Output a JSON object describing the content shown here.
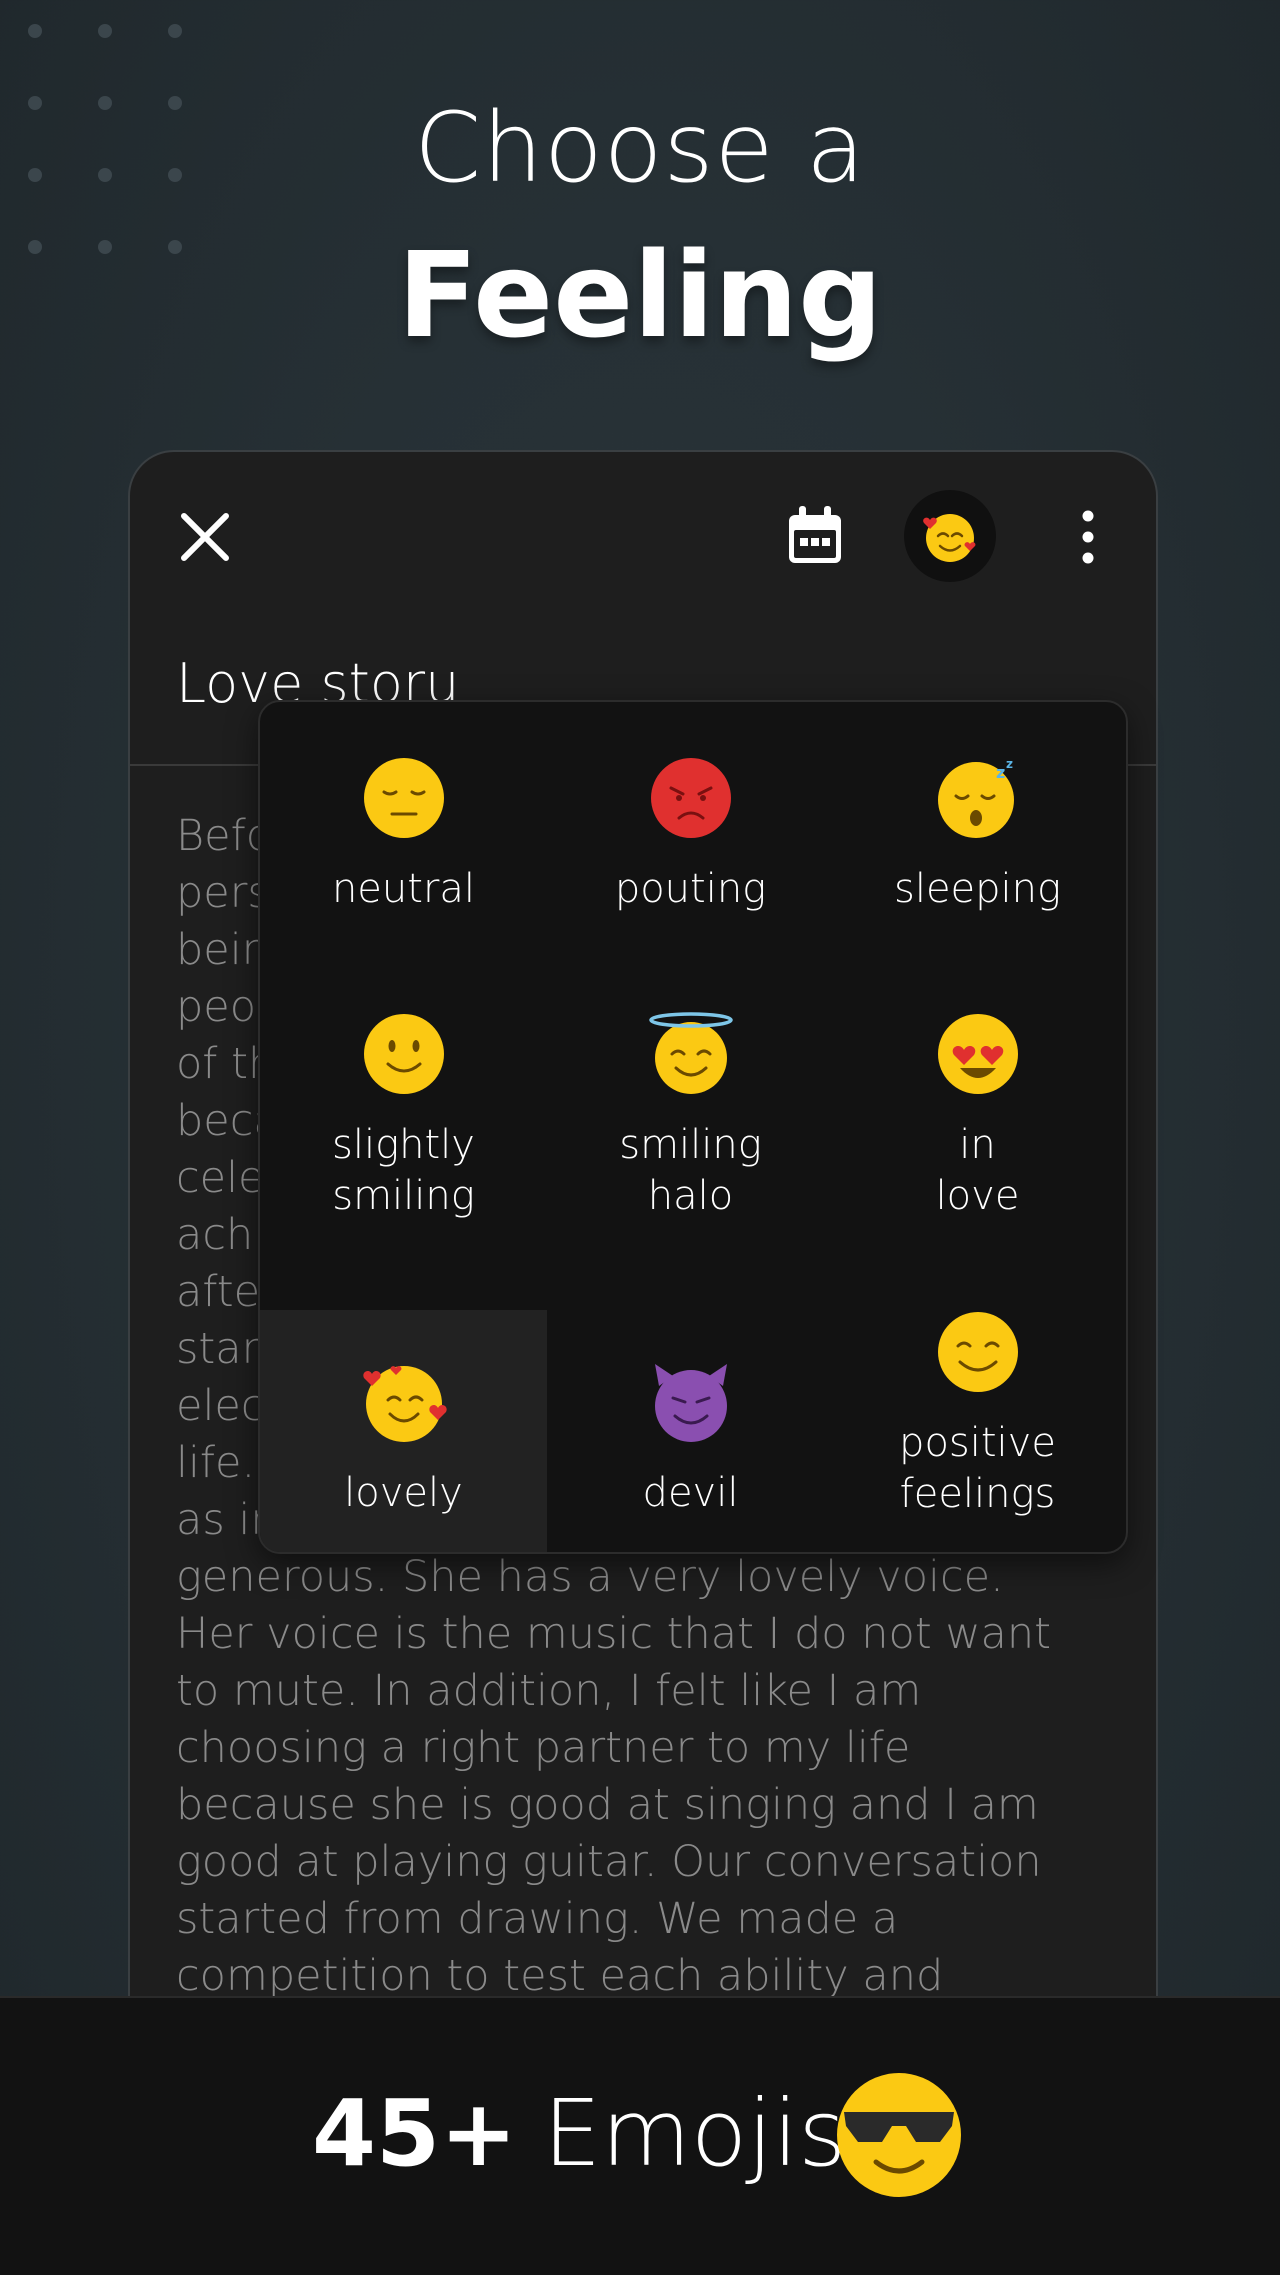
{
  "headline": {
    "line1": "Choose a",
    "line2": "Feeling"
  },
  "toolbar": {
    "close_icon": "close-icon",
    "calendar_icon": "calendar-icon",
    "feeling_icon": "lovely-emoji-icon",
    "more_icon": "more-vert-icon"
  },
  "entry": {
    "title": "Love storu",
    "body": "Befo\npers\nbein\npeo\nof th\nbeca\ncele\nach\nafte\nstar\nelec\nlife.\nas in\ngenerous. She has a very lovely voice.\nHer voice is the music that I do not want\nto mute. In addition, I felt like I am\nchoosing a right partner to my life\nbecause she is good at singing and I am\ngood at playing guitar. Our conversation\nstarted from drawing. We made a\ncompetition to test each ability and"
  },
  "feelings": [
    {
      "label": "neutral",
      "icon": "neutral-face-icon"
    },
    {
      "label": "pouting",
      "icon": "pouting-face-icon"
    },
    {
      "label": "sleeping",
      "icon": "sleeping-face-icon"
    },
    {
      "label": "slightly\nsmiling",
      "icon": "slightly-smiling-face-icon"
    },
    {
      "label": "smiling\nhalo",
      "icon": "smiling-halo-face-icon"
    },
    {
      "label": "in\nlove",
      "icon": "heart-eyes-face-icon"
    },
    {
      "label": "lovely",
      "icon": "smiling-hearts-face-icon",
      "selected": true
    },
    {
      "label": "devil",
      "icon": "smiling-devil-face-icon"
    },
    {
      "label": "positive\nfeelings",
      "icon": "smiling-face-icon"
    }
  ],
  "footer": {
    "count": "45+",
    "text": "Emojis",
    "icon": "sunglasses-face-icon"
  },
  "colors": {
    "background": "#263035",
    "card": "#1e1e1e",
    "popup": "#121212",
    "emoji_yellow": "#fbc913",
    "pouting_red": "#e0302f",
    "devil_purple": "#8a4fb0"
  }
}
